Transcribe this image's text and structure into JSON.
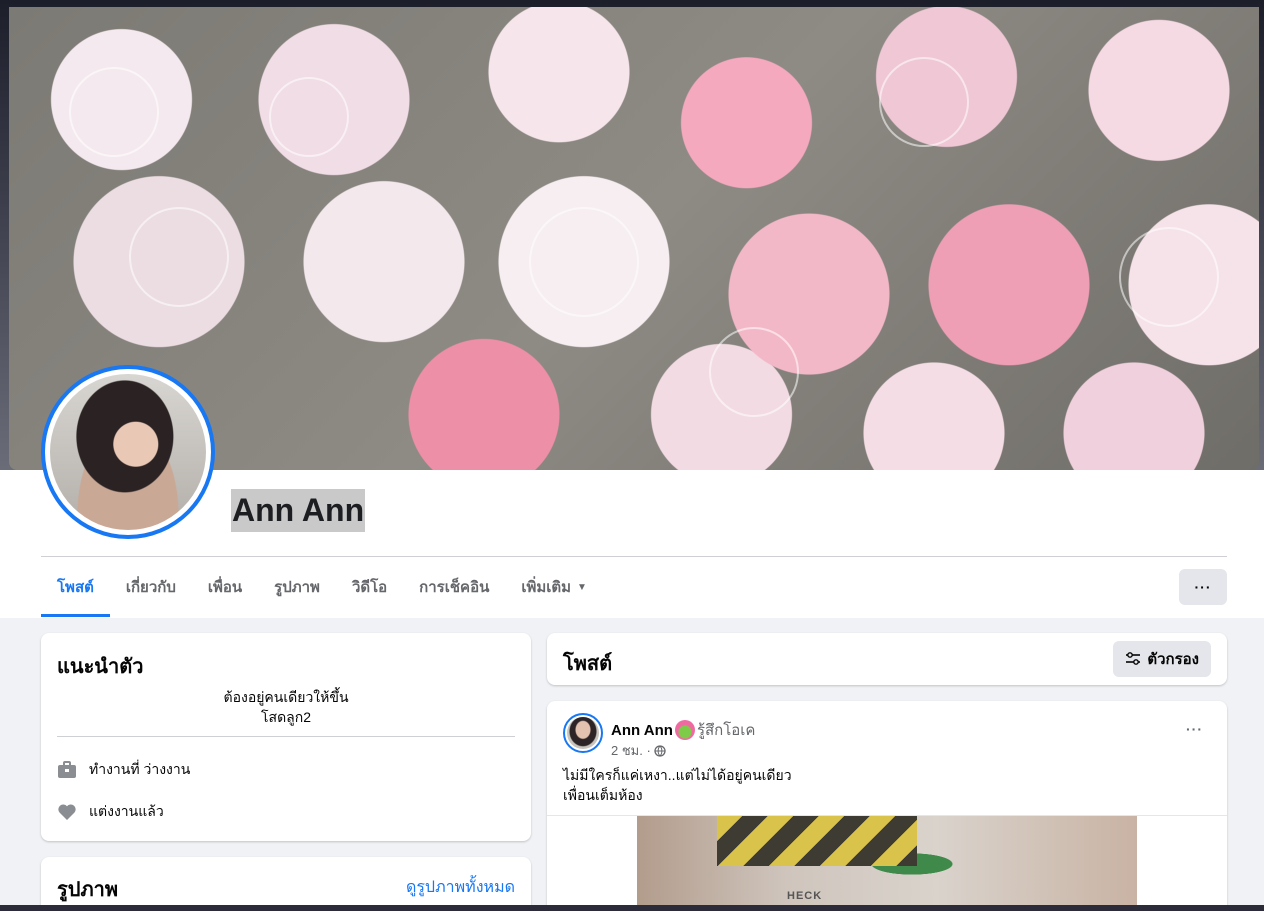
{
  "profile": {
    "name": "Ann Ann"
  },
  "tabs": [
    {
      "label": "โพสต์"
    },
    {
      "label": "เกี่ยวกับ"
    },
    {
      "label": "เพื่อน"
    },
    {
      "label": "รูปภาพ"
    },
    {
      "label": "วิดีโอ"
    },
    {
      "label": "การเช็คอิน"
    },
    {
      "label": "เพิ่มเติม"
    }
  ],
  "active_tab": "โพสต์",
  "more_button_label": "···",
  "intro": {
    "title": "แนะนำตัว",
    "bio_line1": "ต้องอยู่คนเดียวให้ขึ้น",
    "bio_line2": "โสดลูก2",
    "work": "ทำงานที่ ว่างงาน",
    "relationship": "แต่งงานแล้ว"
  },
  "photos": {
    "title": "รูปภาพ",
    "see_all": "ดูรูปภาพทั้งหมด"
  },
  "posts_section": {
    "title": "โพสต์",
    "filter_label": "ตัวกรอง"
  },
  "post": {
    "author": "Ann Ann",
    "feeling": "รู้สึกโอเค",
    "time": "2 ชม. ·",
    "text_line1": "ไม่มีใครก็แค่เหงา..แต่ไม่ได้อยู่คนเดียว",
    "text_line2": "เพื่อนเต็มห้อง",
    "more": "···",
    "image_sign": "HECK"
  },
  "icons": {
    "work": "briefcase-icon",
    "relationship": "heart-icon",
    "filter": "filter-sliders-icon",
    "privacy": "globe-icon"
  },
  "colors": {
    "accent": "#1877f2",
    "feed_background": "#f0f2f5"
  }
}
